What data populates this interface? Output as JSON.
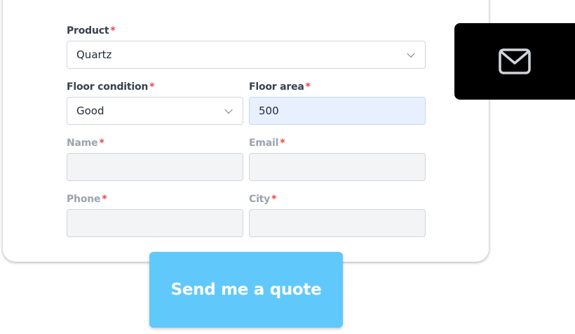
{
  "form": {
    "required_mark": "*",
    "product": {
      "label": "Product",
      "value": "Quartz"
    },
    "floor_condition": {
      "label": "Floor condition",
      "value": "Good"
    },
    "floor_area": {
      "label": "Floor area",
      "value": "500"
    },
    "name": {
      "label": "Name",
      "value": ""
    },
    "email": {
      "label": "Email",
      "value": ""
    },
    "phone": {
      "label": "Phone",
      "value": ""
    },
    "city": {
      "label": "City",
      "value": ""
    },
    "submit_label": "Send me a quote"
  },
  "icons": {
    "mail": "envelope-icon",
    "dropdown": "chevron-down-icon"
  },
  "colors": {
    "required": "#ef4444",
    "submit_bg": "#61c8fb",
    "filled_input_bg": "#e8f0fe",
    "mail_box_bg": "#000000"
  }
}
